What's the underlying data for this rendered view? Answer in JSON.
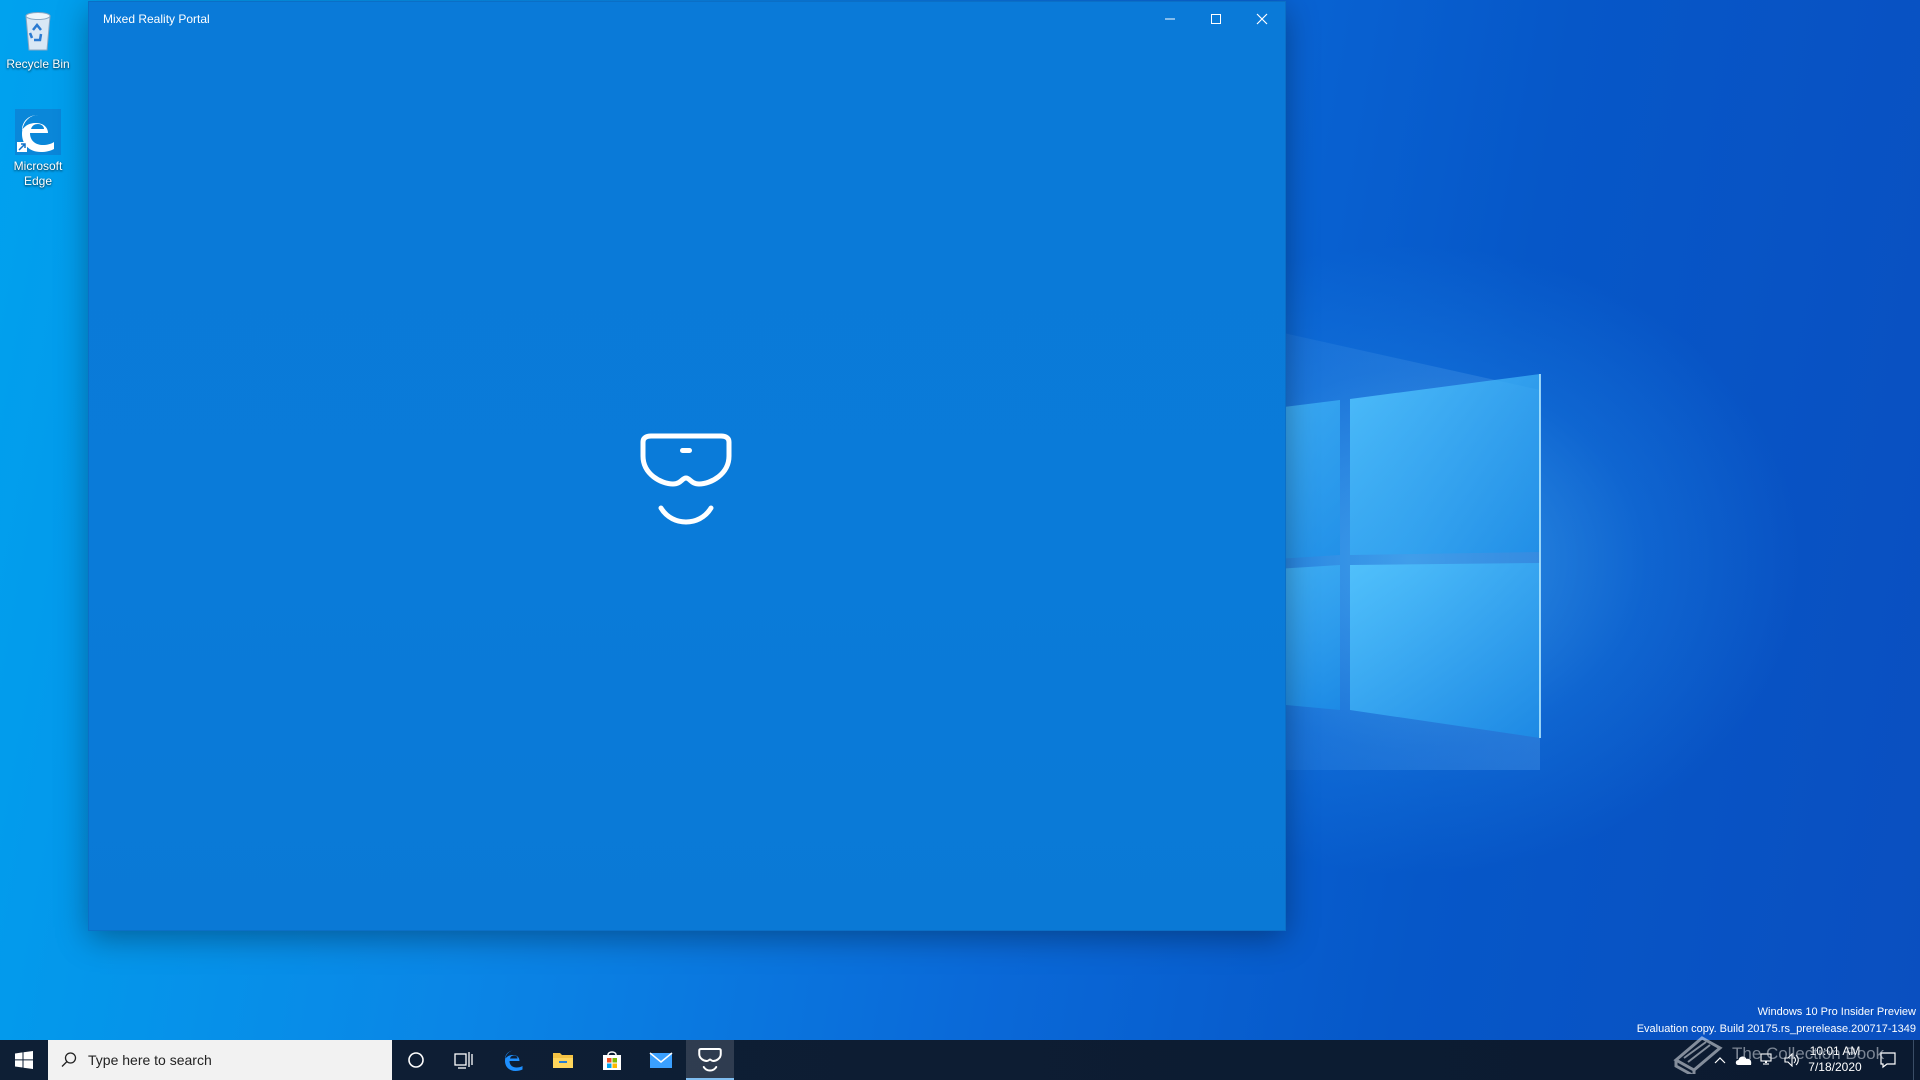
{
  "desktop": {
    "icons": [
      {
        "label": "Recycle Bin",
        "icon": "recycle-bin-icon"
      },
      {
        "label": "Microsoft Edge",
        "icon": "edge-icon"
      }
    ]
  },
  "window": {
    "title": "Mixed Reality Portal",
    "controls": {
      "minimize": "minimize-icon",
      "maximize": "maximize-icon",
      "close": "close-icon"
    },
    "splash_icon": "mixed-reality-headset-icon",
    "background_color": "#0a7ad8"
  },
  "watermark": {
    "line1": "Windows 10 Pro Insider Preview",
    "line2": "Evaluation copy. Build 20175.rs_prerelease.200717-1349"
  },
  "taskbar": {
    "search_placeholder": "Type here to search",
    "pinned": [
      {
        "name": "cortana",
        "icon": "cortana-icon"
      },
      {
        "name": "task-view",
        "icon": "task-view-icon"
      },
      {
        "name": "edge",
        "icon": "edge-icon"
      },
      {
        "name": "file-explorer",
        "icon": "folder-icon"
      },
      {
        "name": "store",
        "icon": "store-icon"
      },
      {
        "name": "mail",
        "icon": "mail-icon"
      },
      {
        "name": "mixed-reality-portal",
        "icon": "mixed-reality-headset-icon",
        "active": true
      }
    ],
    "tray": {
      "icons": [
        "chevron-up-icon",
        "onedrive-icon",
        "network-icon",
        "volume-icon"
      ],
      "time": "10:01 AM",
      "date": "7/18/2020",
      "notification_icon": "notification-icon"
    },
    "overlay_text": "The Collection Book"
  },
  "colors": {
    "taskbar_bg": "#0d1f33",
    "accent": "#0078d7",
    "window_bg": "#0a7ad8"
  }
}
